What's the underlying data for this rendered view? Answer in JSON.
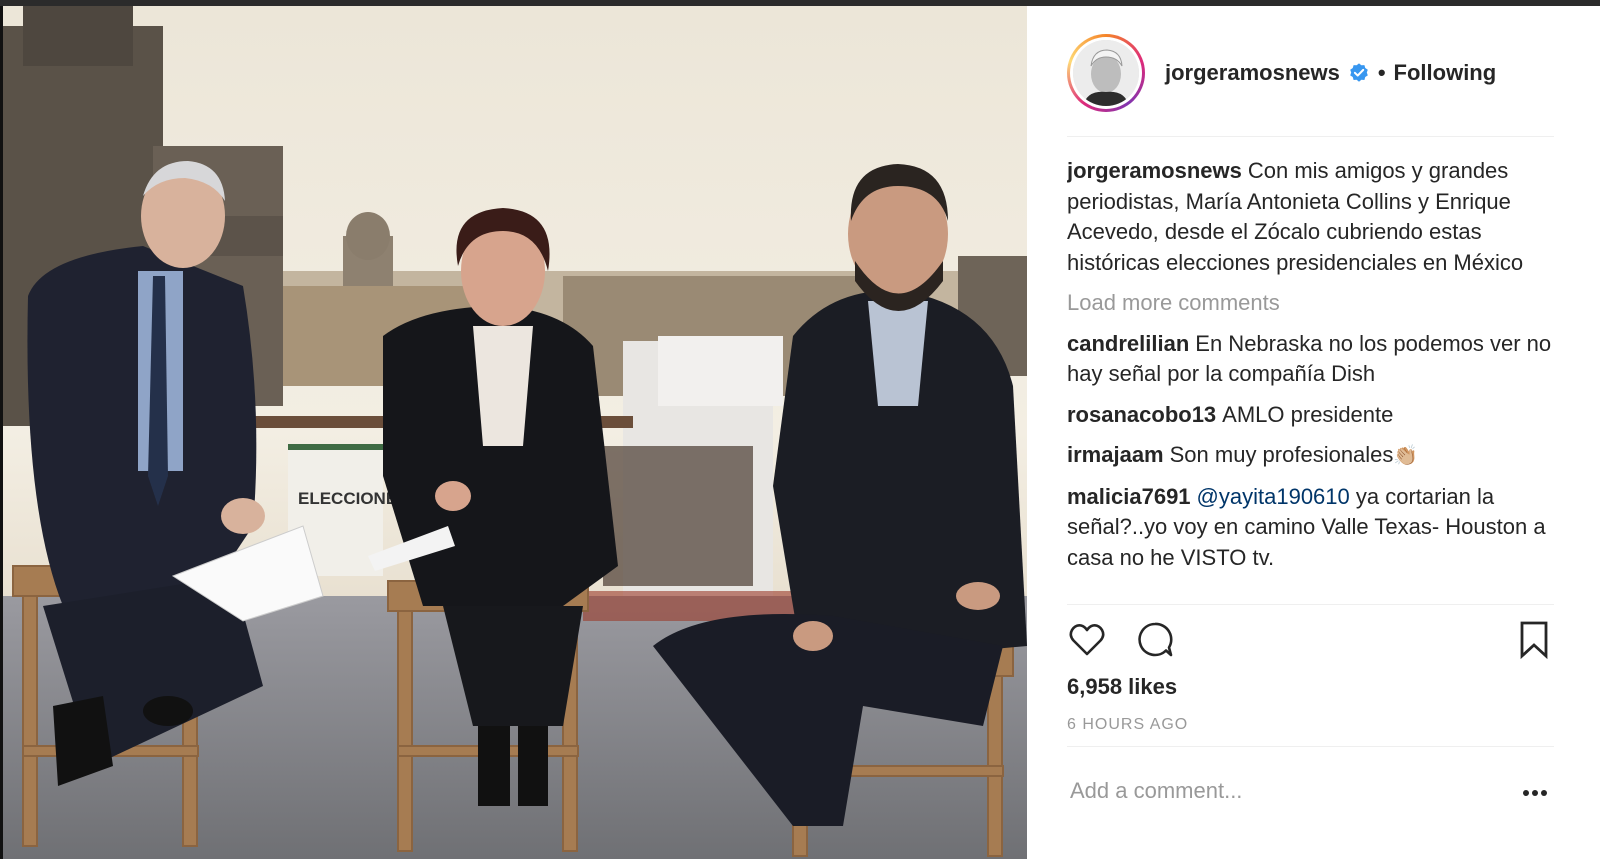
{
  "post": {
    "photo_sign_text": "ELECCIONES MÉXICO 2018"
  },
  "header": {
    "username": "jorgeramosnews",
    "separator": "•",
    "follow_label": "Following",
    "icons": {
      "verified": "verified-badge-icon"
    }
  },
  "caption": {
    "username": "jorgeramosnews",
    "text": "Con mis amigos y grandes periodistas, María Antonieta Collins y Enrique Acevedo, desde el Zócalo cubriendo estas históricas elecciones presidenciales en México"
  },
  "load_more_label": "Load more comments",
  "comments": [
    {
      "username": "candrelilian",
      "text": "En Nebraska no los podemos ver no hay señal por la compañía Dish"
    },
    {
      "username": "rosanacobo13",
      "text": "AMLO presidente"
    },
    {
      "username": "irmajaam",
      "text": "Son muy profesionales",
      "emoji": "👏🏼"
    },
    {
      "username": "malicia7691",
      "mention": "@yayita190610",
      "text": "ya cortarian la señal?..yo voy en camino Valle Texas- Houston a casa no he VISTO tv."
    }
  ],
  "actions": {
    "like_icon": "heart-icon",
    "comment_icon": "comment-icon",
    "save_icon": "bookmark-icon"
  },
  "likes_label": "6,958 likes",
  "time_label": "6 HOURS AGO",
  "add_comment": {
    "placeholder": "Add a comment...",
    "more_label": "..."
  },
  "colors": {
    "accent_link": "#003569",
    "muted": "#999999",
    "text": "#262626",
    "verified": "#3897f0"
  }
}
